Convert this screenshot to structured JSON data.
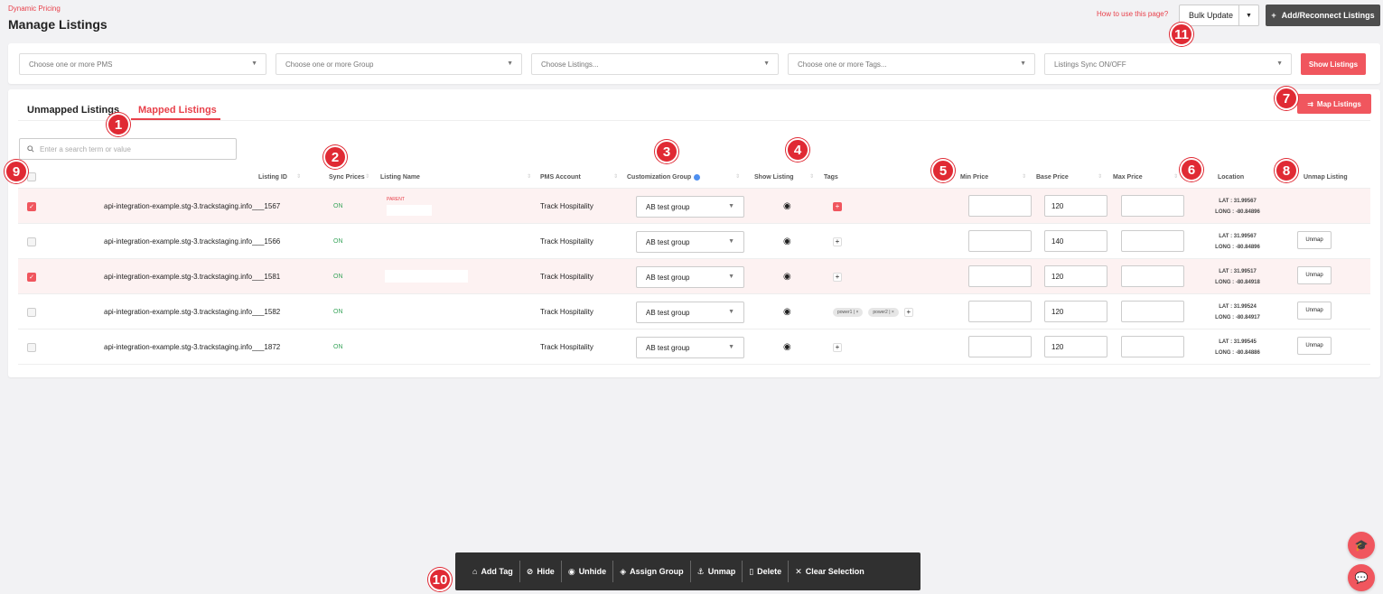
{
  "header": {
    "breadcrumb": "Dynamic Pricing",
    "title": "Manage Listings",
    "howto": "How to use this page?",
    "bulk_update": "Bulk Update",
    "add_reconnect": "Add/Reconnect Listings"
  },
  "filters": {
    "pms": "Choose one or more PMS",
    "group": "Choose one or more Group",
    "listings": "Choose Listings...",
    "tags": "Choose one or more Tags...",
    "sync": "Listings Sync ON/OFF",
    "show_button": "Show Listings"
  },
  "tabs": {
    "unmapped": "Unmapped Listings",
    "mapped": "Mapped Listings",
    "map_button": "Map Listings"
  },
  "search": {
    "placeholder": "Enter a search term or value"
  },
  "columns": {
    "listing_id": "Listing ID",
    "sync": "Sync Prices",
    "name": "Listing Name",
    "pms": "PMS Account",
    "group": "Customization Group",
    "show": "Show Listing",
    "tags": "Tags",
    "min": "Min Price",
    "base": "Base Price",
    "max": "Max Price",
    "location": "Location",
    "unmap": "Unmap Listing"
  },
  "rows": [
    {
      "id": "api-integration-example.stg-3.trackstaging.info___1567",
      "sync": "ON",
      "badge": "PARENT",
      "pms": "Track Hospitality",
      "group": "AB test group",
      "min": "",
      "base": "120",
      "max": "",
      "lat": "LAT : 31.99567",
      "long": "LONG : -80.84896",
      "unmap": ""
    },
    {
      "id": "api-integration-example.stg-3.trackstaging.info___1566",
      "sync": "ON",
      "badge": "",
      "pms": "Track Hospitality",
      "group": "AB test group",
      "min": "",
      "base": "140",
      "max": "",
      "lat": "LAT : 31.99567",
      "long": "LONG : -80.84896",
      "unmap": "Unmap"
    },
    {
      "id": "api-integration-example.stg-3.trackstaging.info___1581",
      "sync": "ON",
      "badge": "",
      "pms": "Track Hospitality",
      "group": "AB test group",
      "min": "",
      "base": "120",
      "max": "",
      "lat": "LAT : 31.99517",
      "long": "LONG : -80.84918",
      "unmap": "Unmap"
    },
    {
      "id": "api-integration-example.stg-3.trackstaging.info___1582",
      "sync": "ON",
      "badge": "",
      "pms": "Track Hospitality",
      "group": "AB test group",
      "min": "",
      "base": "120",
      "max": "",
      "lat": "LAT : 31.99524",
      "long": "LONG : -80.84917",
      "unmap": "Unmap"
    },
    {
      "id": "api-integration-example.stg-3.trackstaging.info___1872",
      "sync": "ON",
      "badge": "",
      "pms": "Track Hospitality",
      "group": "AB test group",
      "min": "",
      "base": "120",
      "max": "",
      "lat": "LAT : 31.99545",
      "long": "LONG : -80.84886",
      "unmap": "Unmap"
    }
  ],
  "tags_row4": [
    "power1",
    "power2"
  ],
  "tag_remove": "×",
  "actions": {
    "add_tag": "Add Tag",
    "hide": "Hide",
    "unhide": "Unhide",
    "assign_group": "Assign Group",
    "unmap": "Unmap",
    "delete": "Delete",
    "clear": "Clear Selection"
  },
  "markers": [
    "1",
    "2",
    "3",
    "4",
    "5",
    "6",
    "7",
    "8",
    "9",
    "10",
    "11"
  ]
}
